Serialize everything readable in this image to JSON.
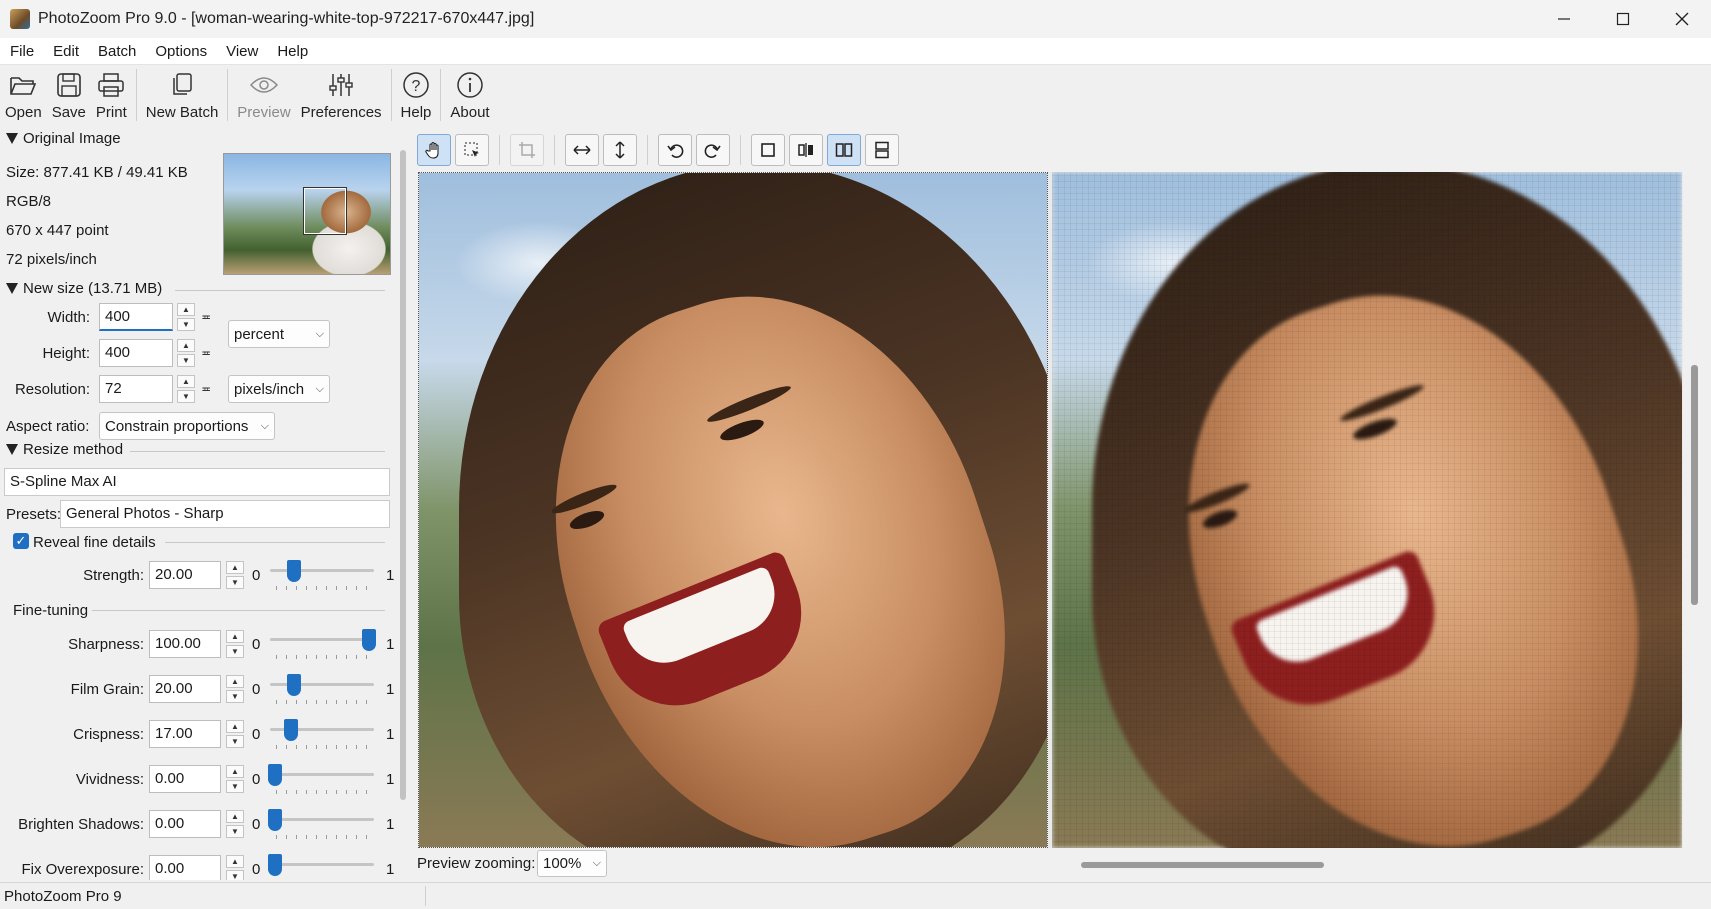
{
  "window": {
    "title": "PhotoZoom Pro 9.0 - [woman-wearing-white-top-972217-670x447.jpg]",
    "minimize_icon": "minimize-icon",
    "maximize_icon": "maximize-icon",
    "close_icon": "close-icon"
  },
  "menu": [
    "File",
    "Edit",
    "Batch",
    "Options",
    "View",
    "Help"
  ],
  "toolbar": {
    "open": "Open",
    "save": "Save",
    "print": "Print",
    "new_batch": "New Batch",
    "preview": "Preview",
    "preferences": "Preferences",
    "help": "Help",
    "about": "About"
  },
  "original_image": {
    "header": "Original Image",
    "size": "Size: 877.41 KB / 49.41 KB",
    "mode": "RGB/8",
    "dimensions": "670 x 447 point",
    "resolution": "72 pixels/inch"
  },
  "new_size": {
    "header": "New size (13.71 MB)",
    "width_label": "Width:",
    "width_value": "400",
    "height_label": "Height:",
    "height_value": "400",
    "resolution_label": "Resolution:",
    "resolution_value": "72",
    "unit": "percent",
    "res_unit": "pixels/inch",
    "aspect_label": "Aspect ratio:",
    "aspect_value": "Constrain proportions"
  },
  "resize_method": {
    "header": "Resize method",
    "method": "S-Spline Max AI",
    "presets_label": "Presets:",
    "presets_value": "General Photos - Sharp",
    "reveal_label": "Reveal fine details",
    "reveal_checked": true,
    "strength_label": "Strength:",
    "strength_value": "20.00",
    "strength_fraction": 0.2
  },
  "fine_tuning": {
    "header": "Fine-tuning",
    "min_label": "0",
    "max_label": "1",
    "rows": [
      {
        "label": "Sharpness:",
        "value": "100.00",
        "fraction": 1.0
      },
      {
        "label": "Film Grain:",
        "value": "20.00",
        "fraction": 0.2
      },
      {
        "label": "Crispness:",
        "value": "17.00",
        "fraction": 0.17
      },
      {
        "label": "Vividness:",
        "value": "0.00",
        "fraction": 0.0
      },
      {
        "label": "Brighten Shadows:",
        "value": "0.00",
        "fraction": 0.0
      },
      {
        "label": "Fix Overexposure:",
        "value": "0.00",
        "fraction": 0.0
      }
    ]
  },
  "preview": {
    "zoom_label": "Preview zooming:",
    "zoom_value": "100%"
  },
  "status": {
    "text": "PhotoZoom Pro 9"
  }
}
